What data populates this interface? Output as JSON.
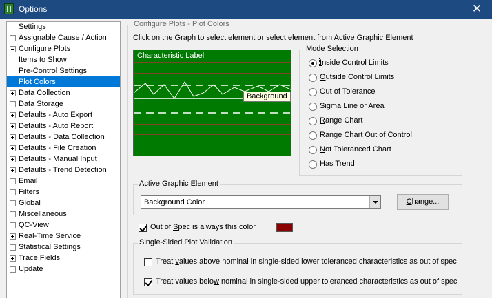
{
  "window": {
    "title": "Options",
    "close_icon": "close-icon"
  },
  "tree": {
    "header": "Settings",
    "items": [
      {
        "label": "Assignable Cause / Action",
        "expander": "none",
        "level": 0
      },
      {
        "label": "Configure Plots",
        "expander": "minus",
        "level": 0
      },
      {
        "label": "Items to Show",
        "expander": "child",
        "level": 1
      },
      {
        "label": "Pre-Control Settings",
        "expander": "child",
        "level": 1
      },
      {
        "label": "Plot Colors",
        "expander": "child",
        "level": 1,
        "selected": true
      },
      {
        "label": "Data Collection",
        "expander": "plus",
        "level": 0
      },
      {
        "label": "Data Storage",
        "expander": "none",
        "level": 0
      },
      {
        "label": "Defaults - Auto Export",
        "expander": "plus",
        "level": 0
      },
      {
        "label": "Defaults - Auto Report",
        "expander": "plus",
        "level": 0
      },
      {
        "label": "Defaults - Data Collection",
        "expander": "plus",
        "level": 0
      },
      {
        "label": "Defaults - File Creation",
        "expander": "plus",
        "level": 0
      },
      {
        "label": "Defaults - Manual Input",
        "expander": "plus",
        "level": 0
      },
      {
        "label": "Defaults - Trend Detection",
        "expander": "plus",
        "level": 0
      },
      {
        "label": "Email",
        "expander": "none",
        "level": 0
      },
      {
        "label": "Filters",
        "expander": "none",
        "level": 0
      },
      {
        "label": "Global",
        "expander": "none",
        "level": 0
      },
      {
        "label": "Miscellaneous",
        "expander": "none",
        "level": 0
      },
      {
        "label": "QC-View",
        "expander": "none",
        "level": 0
      },
      {
        "label": "Real-Time Service",
        "expander": "plus",
        "level": 0
      },
      {
        "label": "Statistical Settings",
        "expander": "none",
        "level": 0
      },
      {
        "label": "Trace Fields",
        "expander": "plus",
        "level": 0
      },
      {
        "label": "Update",
        "expander": "none",
        "level": 0
      }
    ]
  },
  "main": {
    "title": "Configure Plots - Plot Colors",
    "instruction": "Click on the Graph to select element or select element from Active Graphic Element",
    "graph": {
      "label": "Characteristic Label",
      "tooltip": "Background",
      "background_color": "#007a00",
      "limit_line_color": "#a83232",
      "line_color": "#ffffff"
    },
    "mode_selection": {
      "title": "Mode Selection",
      "options": [
        {
          "pre": "",
          "u": "I",
          "post": "nside Control Limits",
          "checked": true
        },
        {
          "pre": "",
          "u": "O",
          "post": "utside Control Limits",
          "checked": false
        },
        {
          "pre": "Out of Tolerance",
          "u": "",
          "post": "",
          "checked": false
        },
        {
          "pre": "Sigma ",
          "u": "L",
          "post": "ine or Area",
          "checked": false
        },
        {
          "pre": "",
          "u": "R",
          "post": "ange Chart",
          "checked": false
        },
        {
          "pre": "Range Chart Out of Control",
          "u": "",
          "post": "",
          "checked": false
        },
        {
          "pre": "",
          "u": "N",
          "post": "ot Toleranced Chart",
          "checked": false
        },
        {
          "pre": "Has ",
          "u": "T",
          "post": "rend",
          "checked": false
        }
      ]
    },
    "active_element": {
      "title_pre": "",
      "title_u": "A",
      "title_post": "ctive Graphic Element",
      "value": "Background Color",
      "change_pre": "",
      "change_u": "C",
      "change_post": "hange..."
    },
    "out_of_spec": {
      "pre": "Out of ",
      "u": "S",
      "post": "pec is always this color",
      "checked": true,
      "color": "#8b0000"
    },
    "single_sided": {
      "title": "Single-Sided Plot Validation",
      "options": [
        {
          "pre": "Treat ",
          "u": "v",
          "post": "alues above nominal in single-sided lower toleranced characteristics as out of spec",
          "checked": false
        },
        {
          "pre": "Treat values belo",
          "u": "w",
          "post": " nominal in single-sided upper toleranced characteristics as out of spec",
          "checked": true
        }
      ]
    }
  }
}
